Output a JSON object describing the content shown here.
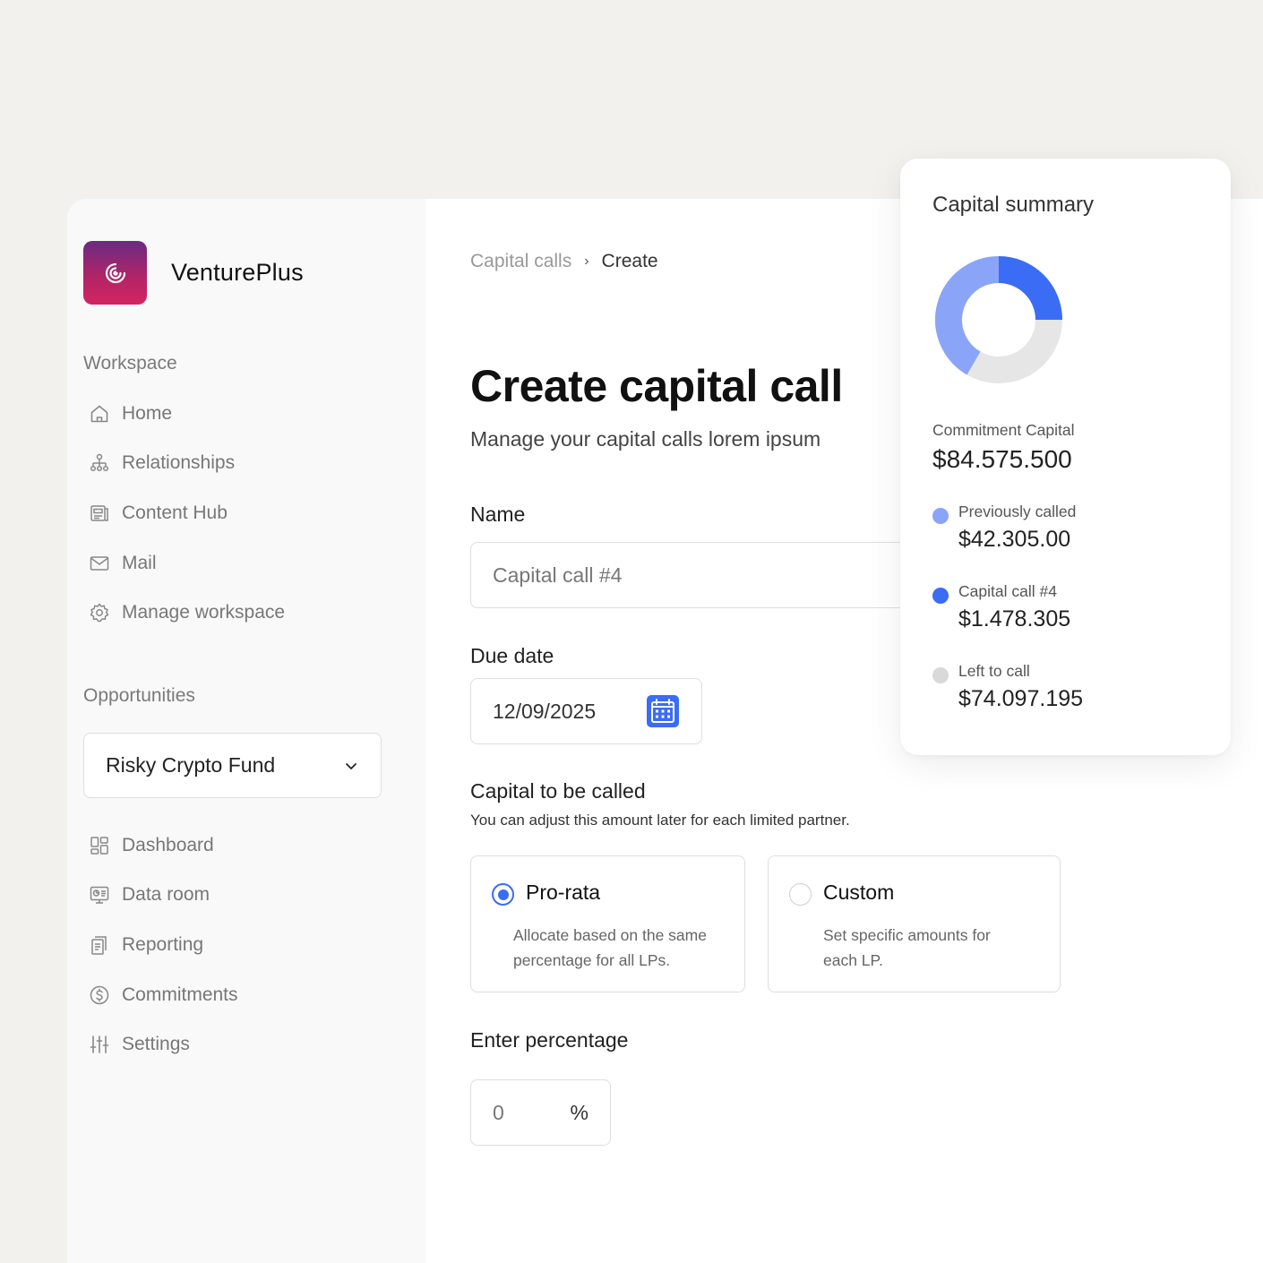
{
  "app": {
    "name": "VenturePlus"
  },
  "sidebar": {
    "workspace_label": "Workspace",
    "workspace_items": [
      {
        "label": "Home",
        "icon": "home-icon"
      },
      {
        "label": "Relationships",
        "icon": "relationships-icon"
      },
      {
        "label": "Content Hub",
        "icon": "content-hub-icon"
      },
      {
        "label": "Mail",
        "icon": "mail-icon"
      },
      {
        "label": "Manage workspace",
        "icon": "gear-icon"
      }
    ],
    "opportunities_label": "Opportunities",
    "fund_selector": {
      "value": "Risky Crypto Fund"
    },
    "fund_items": [
      {
        "label": "Dashboard",
        "icon": "dashboard-icon"
      },
      {
        "label": "Data room",
        "icon": "data-room-icon"
      },
      {
        "label": "Reporting",
        "icon": "reporting-icon"
      },
      {
        "label": "Commitments",
        "icon": "dollar-icon"
      },
      {
        "label": "Settings",
        "icon": "sliders-icon"
      }
    ]
  },
  "breadcrumb": {
    "parent": "Capital calls",
    "separator": "›",
    "current": "Create"
  },
  "header": {
    "title": "Create capital call",
    "subtitle": "Manage your capital calls lorem ipsum"
  },
  "form": {
    "name": {
      "label": "Name",
      "placeholder": "Capital call #4"
    },
    "due_date": {
      "label": "Due date",
      "value": "12/09/2025"
    },
    "capital": {
      "label": "Capital to be called",
      "hint": "You can adjust this amount later for each limited partner.",
      "options": [
        {
          "title": "Pro-rata",
          "line1": "Allocate based on the same",
          "line2": "percentage for all LPs.",
          "selected": true
        },
        {
          "title": "Custom",
          "line1": "Set specific amounts for",
          "line2": "each LP.",
          "selected": false
        }
      ]
    },
    "percentage": {
      "label": "Enter percentage",
      "placeholder": "0",
      "suffix": "%"
    }
  },
  "summary": {
    "title": "Capital summary",
    "commitment_label": "Commitment Capital",
    "commitment_value": "$84.575.500",
    "items": [
      {
        "label": "Previously called",
        "value": "$42.305.00",
        "color": "#8aa5f8"
      },
      {
        "label": "Capital call #4",
        "value": "$1.478.305",
        "color": "#3a6cf6"
      },
      {
        "label": "Left to call",
        "value": "$74.097.195",
        "color": "#d9d9d9"
      }
    ]
  },
  "colors": {
    "accent": "#3a6cf6",
    "accent_light": "#8aa5f8",
    "track": "#e6e6e6"
  }
}
